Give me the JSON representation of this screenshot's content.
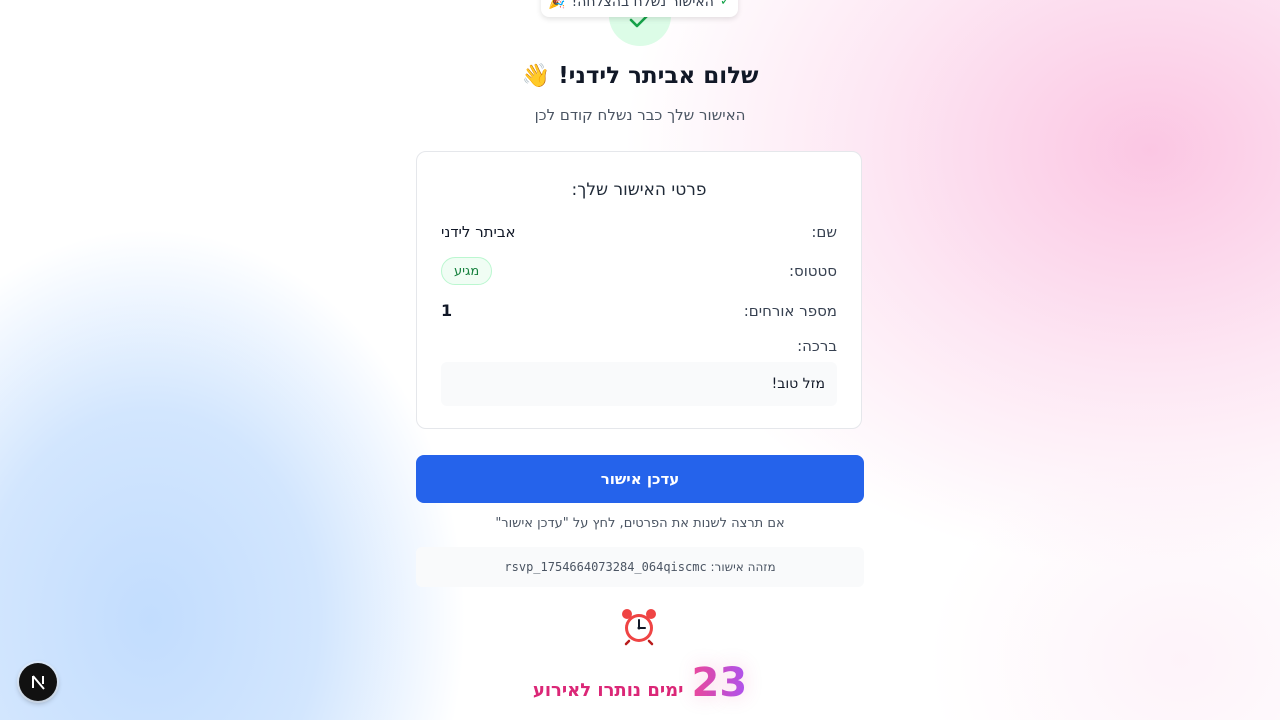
{
  "toast": {
    "text": "האישור נשלח בהצלחה!",
    "emoji": "🎉",
    "icon": "check-icon"
  },
  "header": {
    "greeting": "שלום אביתר לידני!",
    "wave_emoji": "👋",
    "subtitle": "האישור שלך כבר נשלח קודם לכן"
  },
  "details": {
    "title": "פרטי האישור שלך:",
    "name_label": "שם:",
    "name_value": "אביתר לידני",
    "status_label": "סטטוס:",
    "status_value": "מגיע",
    "guests_label": "מספר אורחים:",
    "guests_value": "1",
    "blessing_label": "ברכה:",
    "blessing_value": "מזל טוב!"
  },
  "actions": {
    "update_button": "עדכן אישור",
    "hint": "אם תרצה לשנות את הפרטים, לחץ על \"עדכן אישור\""
  },
  "rsvp": {
    "id_label": "מזהה אישור:",
    "id_value": "rsvp_1754664073284_064qiscmc"
  },
  "countdown": {
    "icon": "alarm-clock-icon",
    "days": "23",
    "text": "ימים נותרו לאירוע"
  },
  "dev_badge": {
    "letter": "N",
    "icon": "nextjs-logo-icon"
  },
  "colors": {
    "primary": "#2563eb",
    "success": "#15803d",
    "accent": "#db2777"
  }
}
